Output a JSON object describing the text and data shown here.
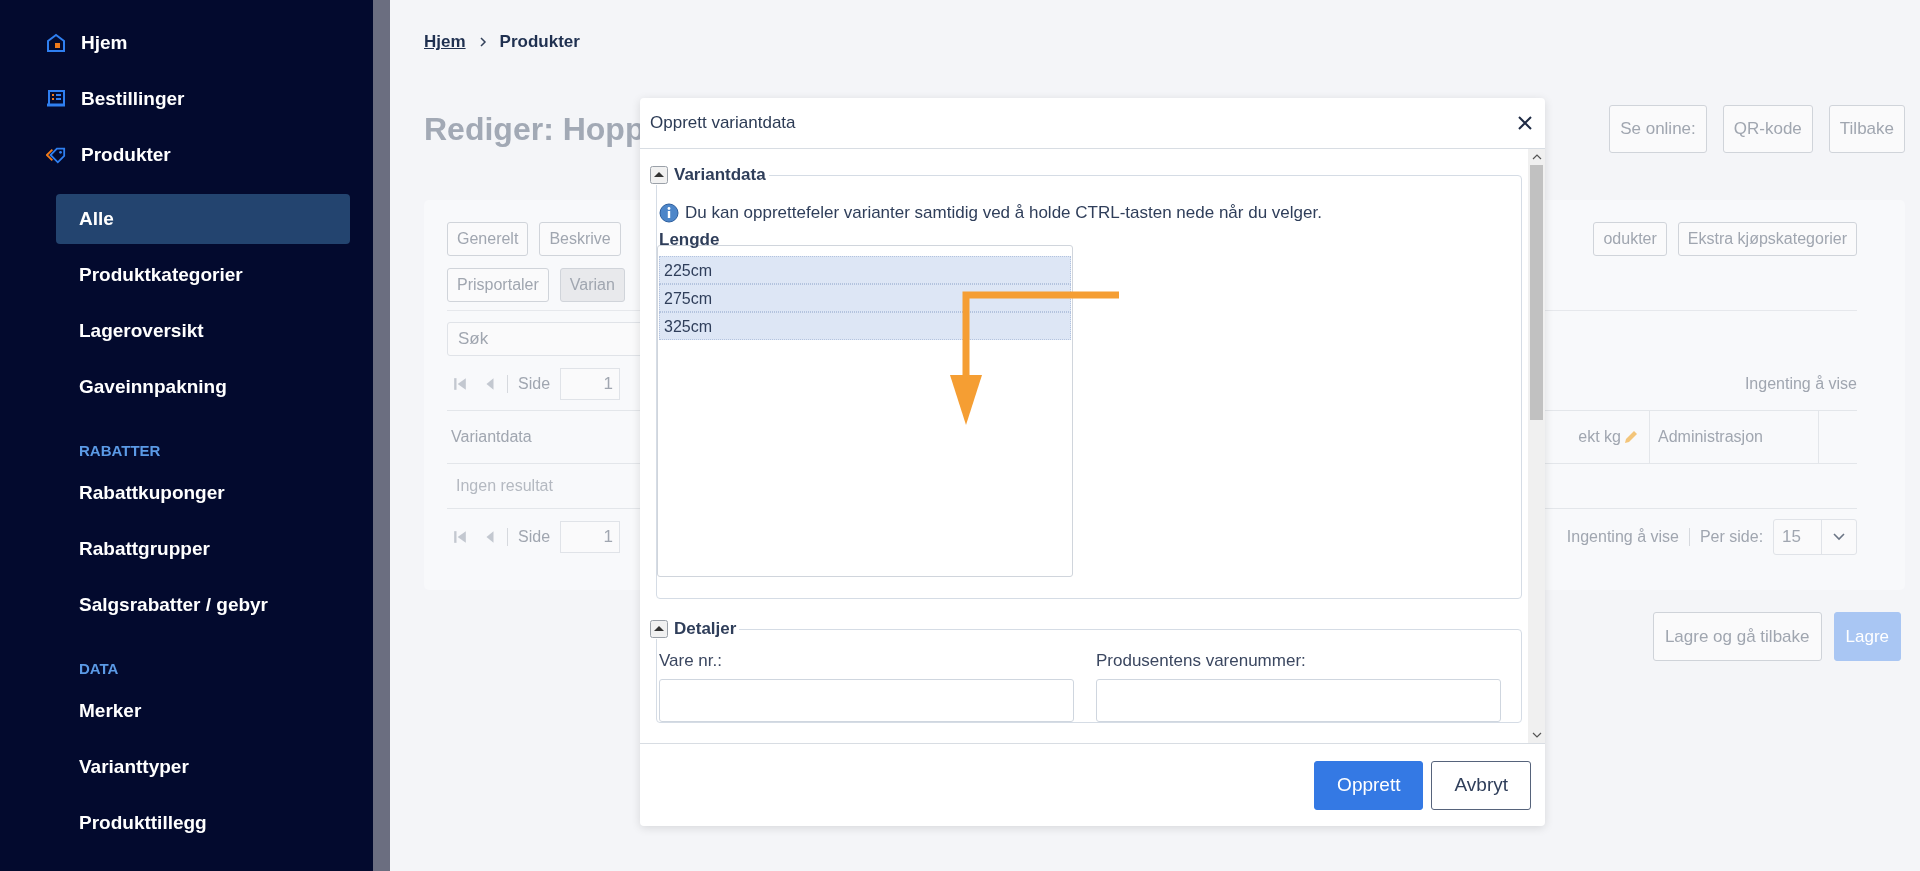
{
  "sidebar": {
    "items": [
      {
        "kind": "main",
        "label": "Hjem",
        "selected": false
      },
      {
        "kind": "main",
        "label": "Bestillinger",
        "selected": false
      },
      {
        "kind": "main",
        "label": "Produkter",
        "selected": false
      },
      {
        "kind": "sub",
        "label": "Alle",
        "selected": true
      },
      {
        "kind": "sub",
        "label": "Produktkategorier",
        "selected": false
      },
      {
        "kind": "sub",
        "label": "Lageroversikt",
        "selected": false
      },
      {
        "kind": "sub",
        "label": "Gaveinnpakning",
        "selected": false
      },
      {
        "kind": "heading",
        "label": "RABATTER"
      },
      {
        "kind": "sub",
        "label": "Rabattkuponger",
        "selected": false
      },
      {
        "kind": "sub",
        "label": "Rabattgrupper",
        "selected": false
      },
      {
        "kind": "sub",
        "label": "Salgsrabatter / gebyr",
        "selected": false
      },
      {
        "kind": "heading",
        "label": "DATA"
      },
      {
        "kind": "sub",
        "label": "Merker",
        "selected": false
      },
      {
        "kind": "sub",
        "label": "Varianttyper",
        "selected": false
      },
      {
        "kind": "sub",
        "label": "Produkttillegg",
        "selected": false
      }
    ]
  },
  "breadcrumb": [
    {
      "kind": "link",
      "label": "Hjem"
    },
    {
      "kind": "current",
      "label": "Produkter"
    }
  ],
  "page_title": "Rediger: Hopp",
  "header_buttons": [
    "Se online:",
    "QR-kode",
    "Tilbake"
  ],
  "tab_rows": [
    {
      "left": [
        {
          "label": "Generelt",
          "selected": false
        },
        {
          "label": "Beskrive",
          "selected": false
        }
      ],
      "right": [
        {
          "label": "odukter",
          "selected": false
        },
        {
          "label": "Ekstra kjøpskategorier",
          "selected": false
        }
      ]
    },
    {
      "left": [
        {
          "label": "Prisportaler",
          "selected": false
        },
        {
          "label": "Varian",
          "selected": true
        }
      ],
      "right": []
    }
  ],
  "search": {
    "placeholder": "Søk"
  },
  "pager_top": {
    "page_label": "Side",
    "page": "1",
    "info": "Ingenting å vise"
  },
  "table": {
    "columns": [
      {
        "label": "Variantdata",
        "kind": "text"
      },
      {
        "label": "ekt kg",
        "kind": "editable"
      },
      {
        "label": "Administrasjon",
        "kind": "text"
      }
    ],
    "empty_text": "Ingen resultat"
  },
  "pager_bottom": {
    "page_label": "Side",
    "page": "1",
    "info": "Ingenting å vise",
    "per_page_label": "Per side:",
    "per_page": "15"
  },
  "actions": [
    {
      "kind": "secondary",
      "label": "Lagre og gå tilbake"
    },
    {
      "kind": "primary",
      "label": "Lagre"
    }
  ],
  "dialog": {
    "title": "Opprett variantdata",
    "sections": [
      {
        "kind": "variants",
        "legend": "Variantdata",
        "expanded": true,
        "info": "Du kan opprettefeler varianter samtidig ved å holde CTRL-tasten nede når du velger.",
        "list_label": "Lengde",
        "options": [
          {
            "label": "225cm",
            "selected": true
          },
          {
            "label": "275cm",
            "selected": true
          },
          {
            "label": "325cm",
            "selected": true
          }
        ]
      },
      {
        "kind": "fields",
        "legend": "Detaljer",
        "expanded": true,
        "fields": [
          {
            "label": "Vare nr.:"
          },
          {
            "label": "Produsentens varenummer:"
          }
        ]
      }
    ],
    "buttons": [
      {
        "kind": "primary",
        "label": "Opprett"
      },
      {
        "kind": "secondary",
        "label": "Avbryt"
      }
    ]
  }
}
